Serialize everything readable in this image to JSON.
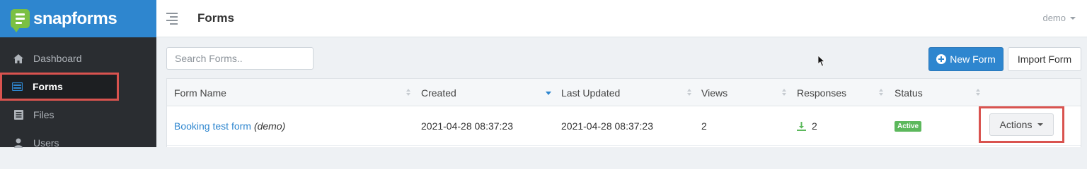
{
  "app": {
    "brand_name": "snapforms",
    "brand_color": "#2e86cf",
    "logo_color": "#7bc043"
  },
  "sidebar": {
    "items": [
      {
        "label": "Dashboard",
        "icon": "home-icon",
        "active": false
      },
      {
        "label": "Forms",
        "icon": "forms-icon",
        "active": true
      },
      {
        "label": "Files",
        "icon": "files-icon",
        "active": false
      },
      {
        "label": "Users",
        "icon": "user-icon",
        "active": false
      }
    ]
  },
  "header": {
    "title": "Forms",
    "user": "demo"
  },
  "toolbar": {
    "search_placeholder": "Search Forms..",
    "new_form_label": "New Form",
    "import_form_label": "Import Form"
  },
  "table": {
    "columns": [
      "Form Name",
      "Created",
      "Last Updated",
      "Views",
      "Responses",
      "Status"
    ],
    "sorted_column": "Created",
    "rows": [
      {
        "name": "Booking test form",
        "name_suffix": "(demo)",
        "created": "2021-04-28 08:37:23",
        "updated": "2021-04-28 08:37:23",
        "views": "2",
        "responses": "2",
        "status": "Active",
        "actions_label": "Actions"
      }
    ]
  },
  "colors": {
    "highlight": "#d9534f",
    "success": "#5cb85c",
    "sidebar_bg": "#2a2d31"
  }
}
